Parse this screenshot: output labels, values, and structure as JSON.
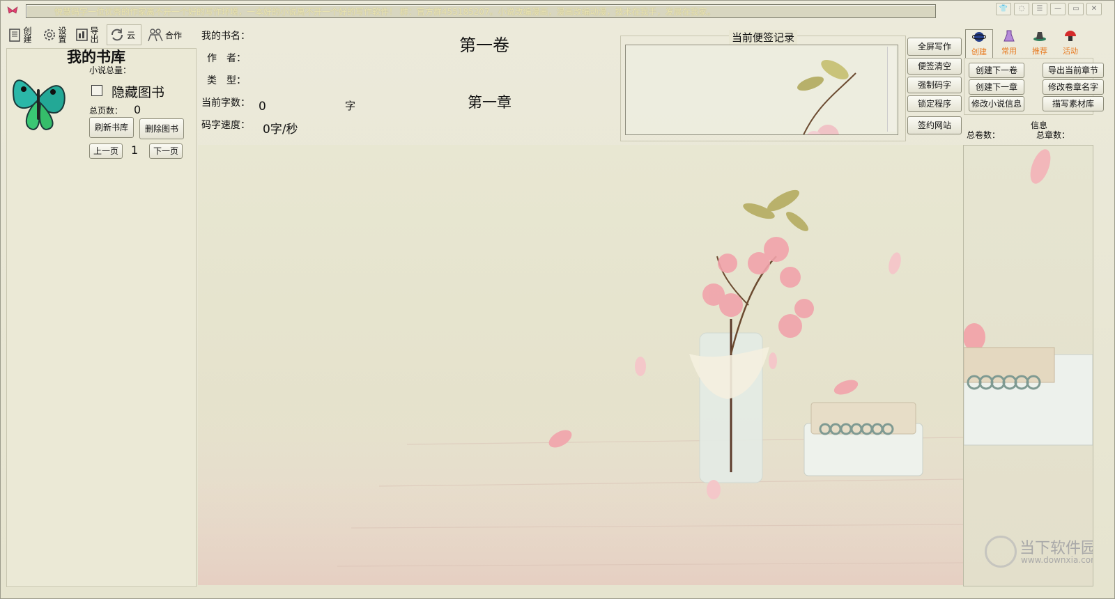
{
  "titlebar": {
    "marquee": "悦慧码字一位优秀的作家离不开一个好的写作环境，一本好的小说离不开一个好的写作软件！ 群：官方群455185207。小说改编漫画，漫画改编动漫，技术在我手，发展在我家。"
  },
  "toolbar": {
    "create": "创建",
    "settings": "设置",
    "export": "导出",
    "cloud": "云",
    "cooperate": "合作"
  },
  "library": {
    "title": "我的书库",
    "total_novels_label": "小说总量：",
    "hide_books": "隐藏图书",
    "total_pages_label": "总页数：",
    "total_pages": "0",
    "refresh": "刷新书库",
    "delete": "删除图书",
    "prev": "上一页",
    "page": "1",
    "next": "下一页"
  },
  "info": {
    "book_name_label": "我的书名：",
    "author_label": "作　者：",
    "type_label": "类　型：",
    "word_count_label": "当前字数：",
    "word_count": "0",
    "word_unit": "字",
    "speed_label": "码字速度：",
    "speed": "0字/秒",
    "volume": "第一卷",
    "chapter": "第一章"
  },
  "notes": {
    "title": "当前便签记录"
  },
  "actions": {
    "fullscreen": "全屏写作",
    "clear_notes": "便签清空",
    "force_type": "强制码字",
    "lock": "锁定程序",
    "sign_site": "签约网站"
  },
  "tabs": [
    "创建",
    "常用",
    "推荐",
    "活动"
  ],
  "right_buttons": {
    "next_volume": "创建下一卷",
    "export_chapter": "导出当前章节",
    "next_chapter": "创建下一章",
    "rename": "修改卷章名字",
    "edit_info": "修改小说信息",
    "materials": "描写素材库"
  },
  "stats": {
    "title": "信息",
    "total_volumes": "总卷数：",
    "total_chapters": "总章数："
  },
  "watermark": {
    "name": "当下软件园",
    "url": "www.downxia.com"
  }
}
